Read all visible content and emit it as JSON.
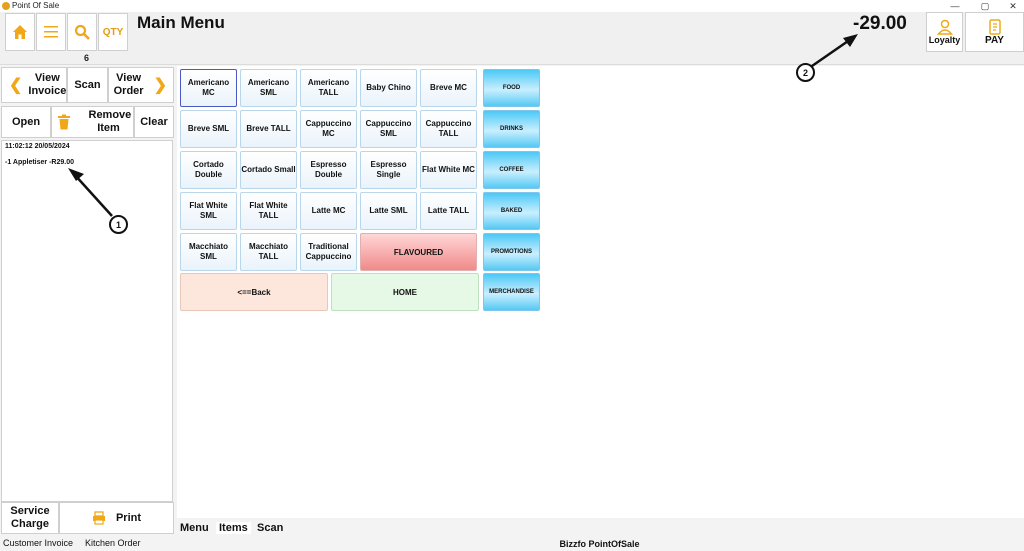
{
  "window": {
    "title": "Point Of Sale",
    "minimize": "—",
    "maximize": "▢",
    "close": "✕"
  },
  "toolbar": {
    "qty_label": "QTY",
    "counter": "6"
  },
  "header": {
    "title": "Main Menu",
    "total": "-29.00",
    "loyalty_label": "Loyalty",
    "pay_label": "PAY"
  },
  "left_nav": {
    "prev_arrow": "❮",
    "next_arrow": "❯",
    "view_invoice": "View Invoice",
    "scan": "Scan",
    "view_order": "View Order",
    "open": "Open",
    "remove_item": "Remove Item",
    "clear": "Clear"
  },
  "receipt": {
    "timestamp": "11:02:12   20/05/2024",
    "lines": [
      {
        "text": "-1  Appletiser  -R29.00"
      }
    ]
  },
  "bottom_left": {
    "service_charge": "Service Charge",
    "print": "Print",
    "tab_customer_invoice": "Customer Invoice",
    "tab_kitchen_order": "Kitchen Order"
  },
  "items": [
    [
      "Americano MC",
      "Americano SML",
      "Americano TALL",
      "Baby Chino",
      "Breve MC"
    ],
    [
      "Breve SML",
      "Breve TALL",
      "Cappuccino MC",
      "Cappuccino SML",
      "Cappuccino TALL"
    ],
    [
      "Cortado Double",
      "Cortado Small",
      "Espresso Double",
      "Espresso Single",
      "Flat White MC"
    ],
    [
      "Flat White SML",
      "Flat White TALL",
      "Latte MC",
      "Latte SML",
      "Latte TALL"
    ],
    [
      "Macchiato SML",
      "Macchiato TALL",
      "Traditional Cappuccino"
    ]
  ],
  "flavoured": "FLAVOURED",
  "nav": {
    "back": "<==Back",
    "home": "HOME"
  },
  "categories": [
    "FOOD",
    "DRINKS",
    "COFFEE",
    "BAKED",
    "PROMOTIONS",
    "MERCHANDISE"
  ],
  "main_tabs": {
    "menu": "Menu",
    "items": "Items",
    "scan": "Scan"
  },
  "status": "Bizzfo PointOfSale",
  "annotations": {
    "one": "1",
    "two": "2"
  },
  "colors": {
    "accent": "#f0a818",
    "selected_border": "#4a58c8",
    "category": "#4cc8f5"
  },
  "icons": [
    "home-icon",
    "menu-icon",
    "search-icon",
    "trash-icon",
    "print-icon",
    "loyalty-icon",
    "pay-icon"
  ]
}
